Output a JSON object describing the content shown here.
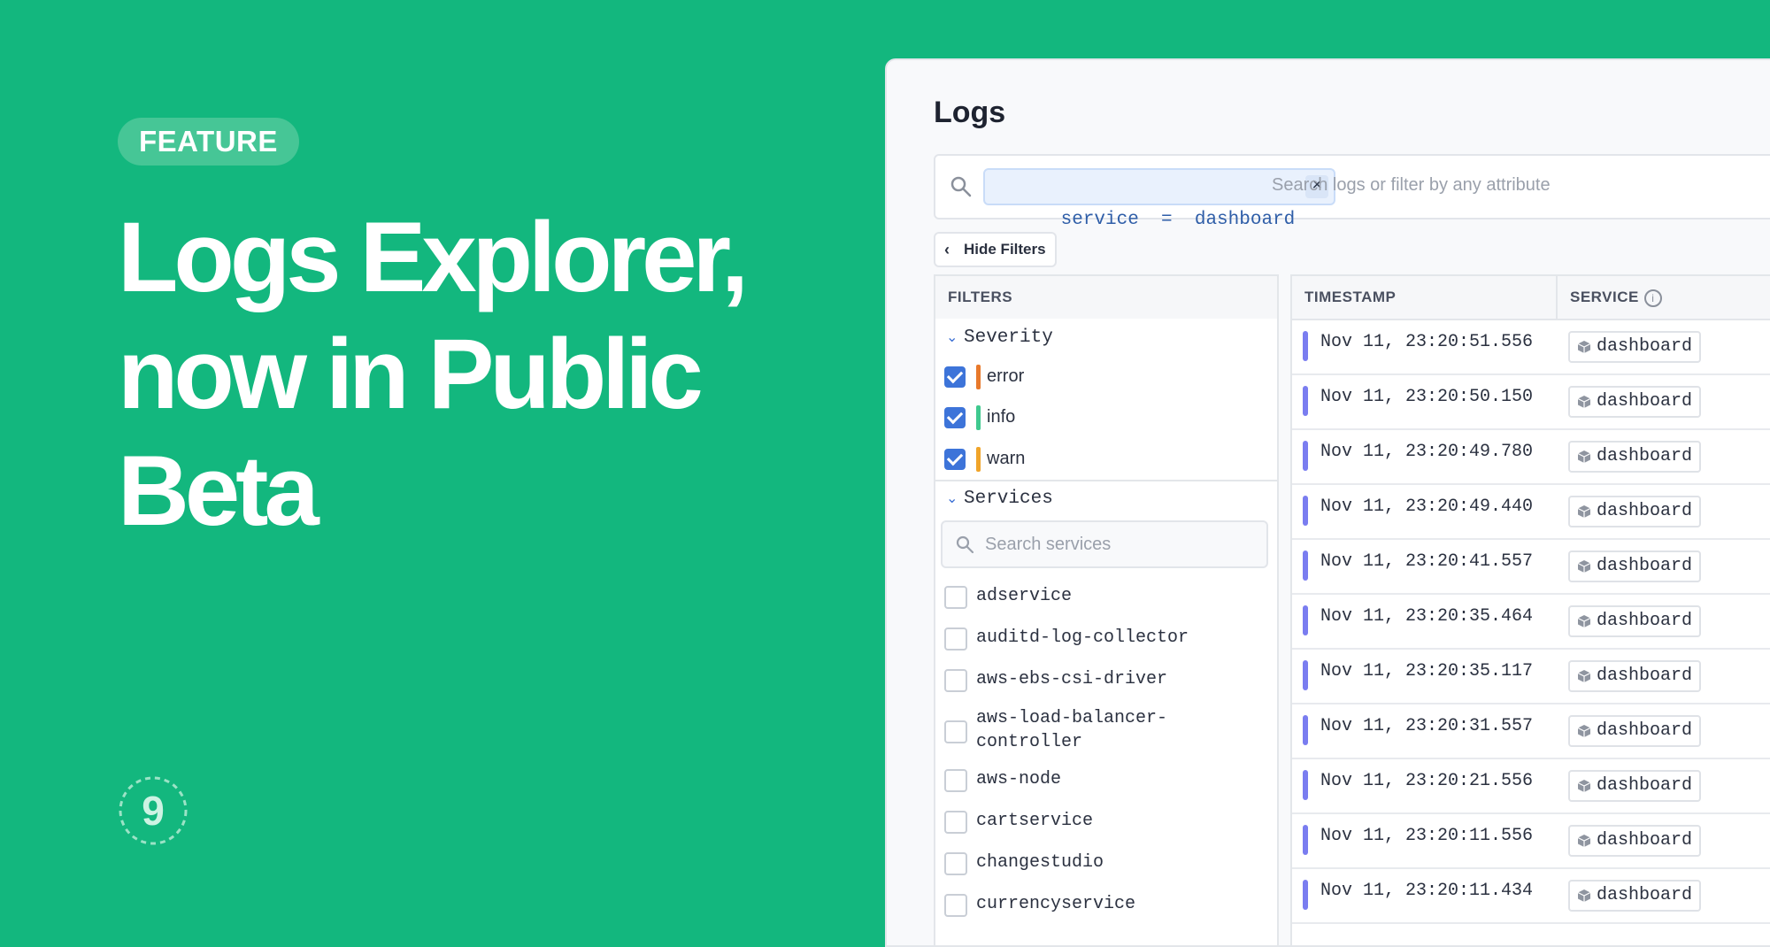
{
  "promo": {
    "badge": "FEATURE",
    "headline_lines": [
      "Logs Explorer,",
      "now in Public",
      "Beta"
    ]
  },
  "app": {
    "title": "Logs",
    "search": {
      "chip": "service  =  dashboard",
      "chip_close": "×",
      "placeholder": "Search logs or filter by any attribute"
    },
    "hide_filters_label": "Hide Filters",
    "filters": {
      "header": "FILTERS",
      "severity": {
        "title": "Severity",
        "items": [
          {
            "label": "error",
            "checked": true,
            "color": "#e8792b"
          },
          {
            "label": "info",
            "checked": true,
            "color": "#3fc98f"
          },
          {
            "label": "warn",
            "checked": true,
            "color": "#f0a429"
          }
        ]
      },
      "services": {
        "title": "Services",
        "search_placeholder": "Search services",
        "items": [
          {
            "label": "adservice"
          },
          {
            "label": "auditd-log-collector"
          },
          {
            "label": "aws-ebs-csi-driver"
          },
          {
            "label": "aws-load-balancer-\ncontroller"
          },
          {
            "label": "aws-node"
          },
          {
            "label": "cartservice"
          },
          {
            "label": "changestudio"
          },
          {
            "label": "currencyservice"
          }
        ]
      }
    },
    "table": {
      "columns": [
        "TIMESTAMP",
        "SERVICE"
      ],
      "rows": [
        {
          "timestamp": "Nov 11, 23:20:51.556",
          "service": "dashboard"
        },
        {
          "timestamp": "Nov 11, 23:20:50.150",
          "service": "dashboard"
        },
        {
          "timestamp": "Nov 11, 23:20:49.780",
          "service": "dashboard"
        },
        {
          "timestamp": "Nov 11, 23:20:49.440",
          "service": "dashboard"
        },
        {
          "timestamp": "Nov 11, 23:20:41.557",
          "service": "dashboard"
        },
        {
          "timestamp": "Nov 11, 23:20:35.464",
          "service": "dashboard"
        },
        {
          "timestamp": "Nov 11, 23:20:35.117",
          "service": "dashboard"
        },
        {
          "timestamp": "Nov 11, 23:20:31.557",
          "service": "dashboard"
        },
        {
          "timestamp": "Nov 11, 23:20:21.556",
          "service": "dashboard"
        },
        {
          "timestamp": "Nov 11, 23:20:11.556",
          "service": "dashboard"
        },
        {
          "timestamp": "Nov 11, 23:20:11.434",
          "service": "dashboard"
        }
      ]
    }
  },
  "colors": {
    "background": "#13b77e",
    "accent": "#3d74d9",
    "log_level": "#7a7df0"
  },
  "brand_logo_text": "9"
}
